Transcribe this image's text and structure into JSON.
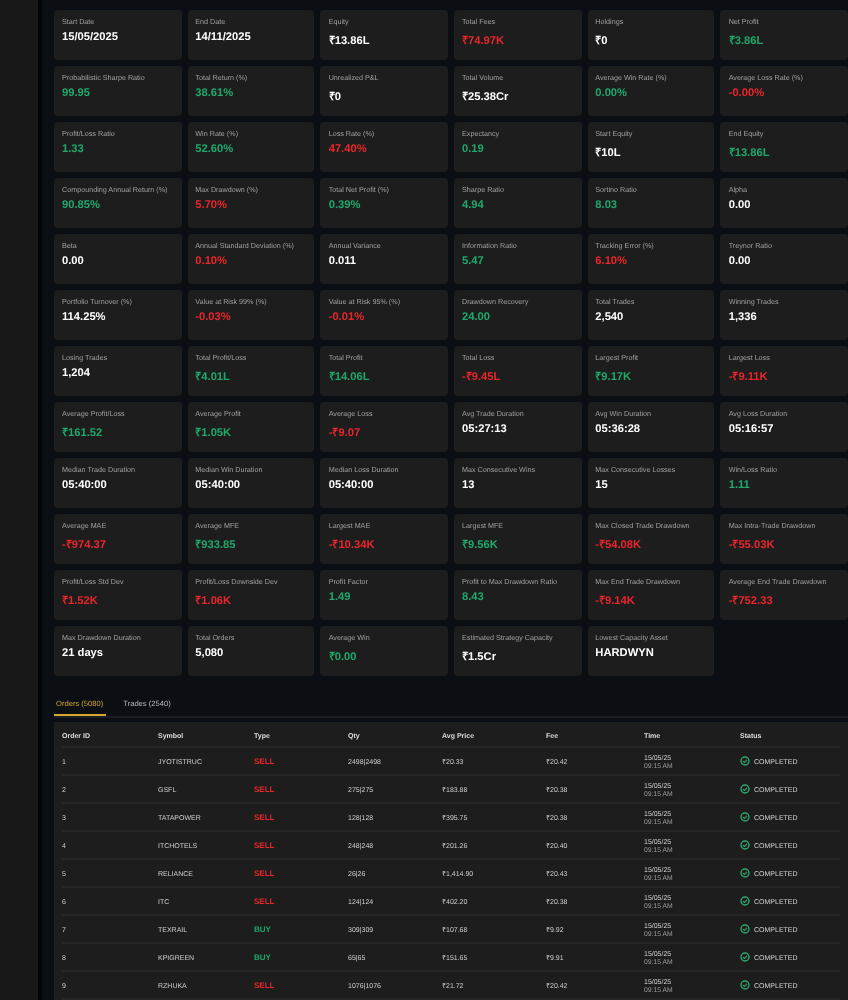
{
  "metrics": [
    {
      "label": "Start Date",
      "value": "15/05/2025",
      "color": "#ffffff"
    },
    {
      "label": "End Date",
      "value": "14/11/2025",
      "color": "#ffffff"
    },
    {
      "label": "Equity",
      "value": "₹13.86L",
      "color": "#ffffff"
    },
    {
      "label": "Total Fees",
      "value": "₹74.97K",
      "color": "#e8262b"
    },
    {
      "label": "Holdings",
      "value": "₹0",
      "color": "#ffffff"
    },
    {
      "label": "Net Profit",
      "value": "₹3.86L",
      "color": "#1fa86b"
    },
    {
      "label": "Probabilistic Sharpe Ratio",
      "value": "99.95",
      "color": "#1fa86b"
    },
    {
      "label": "Total Return (%)",
      "value": "38.61%",
      "color": "#1fa86b"
    },
    {
      "label": "Unrealized P&L",
      "value": "₹0",
      "color": "#ffffff"
    },
    {
      "label": "Total Volume",
      "value": "₹25.38Cr",
      "color": "#ffffff"
    },
    {
      "label": "Average Win Rate (%)",
      "value": "0.00%",
      "color": "#1fa86b"
    },
    {
      "label": "Average Loss Rate (%)",
      "value": "-0.00%",
      "color": "#e8262b"
    },
    {
      "label": "Profit/Loss Ratio",
      "value": "1.33",
      "color": "#1fa86b"
    },
    {
      "label": "Win Rate (%)",
      "value": "52.60%",
      "color": "#1fa86b"
    },
    {
      "label": "Loss Rate (%)",
      "value": "47.40%",
      "color": "#e8262b"
    },
    {
      "label": "Expectancy",
      "value": "0.19",
      "color": "#1fa86b"
    },
    {
      "label": "Start Equity",
      "value": "₹10L",
      "color": "#ffffff"
    },
    {
      "label": "End Equity",
      "value": "₹13.86L",
      "color": "#1fa86b"
    },
    {
      "label": "Compounding Annual Return (%)",
      "value": "90.85%",
      "color": "#1fa86b"
    },
    {
      "label": "Max Drawdown (%)",
      "value": "5.70%",
      "color": "#e8262b"
    },
    {
      "label": "Total Net Profit (%)",
      "value": "0.39%",
      "color": "#1fa86b"
    },
    {
      "label": "Sharpe Ratio",
      "value": "4.94",
      "color": "#1fa86b"
    },
    {
      "label": "Sortino Ratio",
      "value": "8.03",
      "color": "#1fa86b"
    },
    {
      "label": "Alpha",
      "value": "0.00",
      "color": "#ffffff"
    },
    {
      "label": "Beta",
      "value": "0.00",
      "color": "#ffffff"
    },
    {
      "label": "Annual Standard Deviation (%)",
      "value": "0.10%",
      "color": "#e8262b"
    },
    {
      "label": "Annual Variance",
      "value": "0.011",
      "color": "#ffffff"
    },
    {
      "label": "Information Ratio",
      "value": "5.47",
      "color": "#1fa86b"
    },
    {
      "label": "Tracking Error (%)",
      "value": "6.10%",
      "color": "#e8262b"
    },
    {
      "label": "Treynor Ratio",
      "value": "0.00",
      "color": "#ffffff"
    },
    {
      "label": "Portfolio Turnover (%)",
      "value": "114.25%",
      "color": "#ffffff"
    },
    {
      "label": "Value at Risk 99% (%)",
      "value": "-0.03%",
      "color": "#e8262b"
    },
    {
      "label": "Value at Risk 95% (%)",
      "value": "-0.01%",
      "color": "#e8262b"
    },
    {
      "label": "Drawdown Recovery",
      "value": "24.00",
      "color": "#1fa86b"
    },
    {
      "label": "Total Trades",
      "value": "2,540",
      "color": "#ffffff"
    },
    {
      "label": "Winning Trades",
      "value": "1,336",
      "color": "#ffffff"
    },
    {
      "label": "Losing Trades",
      "value": "1,204",
      "color": "#ffffff"
    },
    {
      "label": "Total Profit/Loss",
      "value": "₹4.01L",
      "color": "#1fa86b"
    },
    {
      "label": "Total Profit",
      "value": "₹14.06L",
      "color": "#1fa86b"
    },
    {
      "label": "Total Loss",
      "value": "-₹9.45L",
      "color": "#e8262b"
    },
    {
      "label": "Largest Profit",
      "value": "₹9.17K",
      "color": "#1fa86b"
    },
    {
      "label": "Largest Loss",
      "value": "-₹9.11K",
      "color": "#e8262b"
    },
    {
      "label": "Average Profit/Loss",
      "value": "₹161.52",
      "color": "#1fa86b"
    },
    {
      "label": "Average Profit",
      "value": "₹1.05K",
      "color": "#1fa86b"
    },
    {
      "label": "Average Loss",
      "value": "-₹9.07",
      "color": "#e8262b"
    },
    {
      "label": "Avg Trade Duration",
      "value": "05:27:13",
      "color": "#ffffff"
    },
    {
      "label": "Avg Win Duration",
      "value": "05:36:28",
      "color": "#ffffff"
    },
    {
      "label": "Avg Loss Duration",
      "value": "05:16:57",
      "color": "#ffffff"
    },
    {
      "label": "Median Trade Duration",
      "value": "05:40:00",
      "color": "#ffffff"
    },
    {
      "label": "Median Win Duration",
      "value": "05:40:00",
      "color": "#ffffff"
    },
    {
      "label": "Median Loss Duration",
      "value": "05:40:00",
      "color": "#ffffff"
    },
    {
      "label": "Max Consecutive Wins",
      "value": "13",
      "color": "#ffffff"
    },
    {
      "label": "Max Consecutive Losses",
      "value": "15",
      "color": "#ffffff"
    },
    {
      "label": "Win/Loss Ratio",
      "value": "1.11",
      "color": "#1fa86b"
    },
    {
      "label": "Average MAE",
      "value": "-₹974.37",
      "color": "#e8262b"
    },
    {
      "label": "Average MFE",
      "value": "₹933.85",
      "color": "#1fa86b"
    },
    {
      "label": "Largest MAE",
      "value": "-₹10.34K",
      "color": "#e8262b"
    },
    {
      "label": "Largest MFE",
      "value": "₹9.56K",
      "color": "#1fa86b"
    },
    {
      "label": "Max Closed Trade Drawdown",
      "value": "-₹54.08K",
      "color": "#e8262b"
    },
    {
      "label": "Max Intra-Trade Drawdown",
      "value": "-₹55.03K",
      "color": "#e8262b"
    },
    {
      "label": "Profit/Loss Std Dev",
      "value": "₹1.52K",
      "color": "#e8262b"
    },
    {
      "label": "Profit/Loss Downside Dev",
      "value": "₹1.06K",
      "color": "#e8262b"
    },
    {
      "label": "Profit Factor",
      "value": "1.49",
      "color": "#1fa86b"
    },
    {
      "label": "Profit to Max Drawdown Ratio",
      "value": "8.43",
      "color": "#1fa86b"
    },
    {
      "label": "Max End Trade Drawdown",
      "value": "-₹9.14K",
      "color": "#e8262b"
    },
    {
      "label": "Average End Trade Drawdown",
      "value": "-₹752.33",
      "color": "#e8262b"
    },
    {
      "label": "Max Drawdown Duration",
      "value": "21 days",
      "color": "#ffffff"
    },
    {
      "label": "Total Orders",
      "value": "5,080",
      "color": "#ffffff"
    },
    {
      "label": "Average Win",
      "value": "₹0.00",
      "color": "#1fa86b"
    },
    {
      "label": "Estimated Strategy Capacity",
      "value": "₹1.5Cr",
      "color": "#ffffff"
    },
    {
      "label": "Lowest Capacity Asset",
      "value": "HARDWYN",
      "color": "#ffffff"
    }
  ],
  "tabs": [
    {
      "label": "Orders (5080)",
      "selected": true
    },
    {
      "label": "Trades (2540)",
      "selected": false
    }
  ],
  "table": {
    "columns": [
      "Order ID",
      "Symbol",
      "Type",
      "Qty",
      "Avg Price",
      "Fee",
      "Time",
      "Status"
    ],
    "rows": [
      {
        "id": "1",
        "symbol": "JYOTISTRUC",
        "type": "SELL",
        "color": "#e8262b",
        "qty": "2498|2498",
        "price": "₹20.33",
        "fee": "₹20.42",
        "date": "15/05/25",
        "time": "09:15 AM",
        "status": "COMPLETED"
      },
      {
        "id": "2",
        "symbol": "GSFL",
        "type": "SELL",
        "color": "#e8262b",
        "qty": "275|275",
        "price": "₹183.88",
        "fee": "₹20.38",
        "date": "15/05/25",
        "time": "09:15 AM",
        "status": "COMPLETED"
      },
      {
        "id": "3",
        "symbol": "TATAPOWER",
        "type": "SELL",
        "color": "#e8262b",
        "qty": "128|128",
        "price": "₹395.75",
        "fee": "₹20.38",
        "date": "15/05/25",
        "time": "09:15 AM",
        "status": "COMPLETED"
      },
      {
        "id": "4",
        "symbol": "ITCHOTELS",
        "type": "SELL",
        "color": "#e8262b",
        "qty": "248|248",
        "price": "₹201.26",
        "fee": "₹20.40",
        "date": "15/05/25",
        "time": "09:15 AM",
        "status": "COMPLETED"
      },
      {
        "id": "5",
        "symbol": "RELIANCE",
        "type": "SELL",
        "color": "#e8262b",
        "qty": "26|26",
        "price": "₹1,414.90",
        "fee": "₹20.43",
        "date": "15/05/25",
        "time": "09:15 AM",
        "status": "COMPLETED"
      },
      {
        "id": "6",
        "symbol": "ITC",
        "type": "SELL",
        "color": "#e8262b",
        "qty": "124|124",
        "price": "₹402.20",
        "fee": "₹20.38",
        "date": "15/05/25",
        "time": "09:15 AM",
        "status": "COMPLETED"
      },
      {
        "id": "7",
        "symbol": "TEXRAIL",
        "type": "BUY",
        "color": "#1fa86b",
        "qty": "309|309",
        "price": "₹107.68",
        "fee": "₹9.92",
        "date": "15/05/25",
        "time": "09:15 AM",
        "status": "COMPLETED"
      },
      {
        "id": "8",
        "symbol": "KPIGREEN",
        "type": "BUY",
        "color": "#1fa86b",
        "qty": "65|65",
        "price": "₹151.65",
        "fee": "₹9.91",
        "date": "15/05/25",
        "time": "09:15 AM",
        "status": "COMPLETED"
      },
      {
        "id": "9",
        "symbol": "RZHUKA",
        "type": "SELL",
        "color": "#e8262b",
        "qty": "1076|1076",
        "price": "₹21.72",
        "fee": "₹20.42",
        "date": "15/05/25",
        "time": "09:15 AM",
        "status": "COMPLETED"
      }
    ]
  }
}
